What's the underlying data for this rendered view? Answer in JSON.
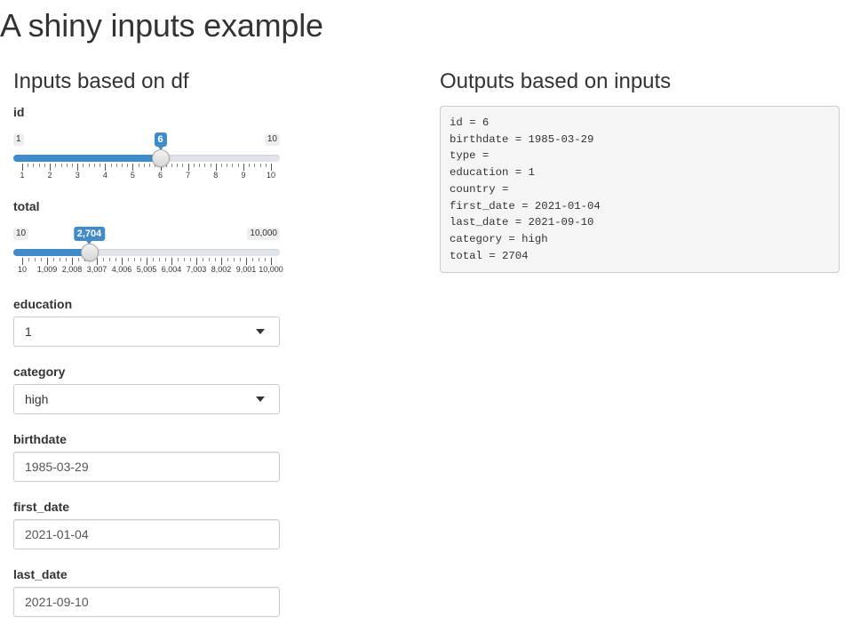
{
  "app": {
    "title": "A shiny inputs example"
  },
  "inputs_panel": {
    "title": "Inputs based on df",
    "id_slider": {
      "label": "id",
      "min_label": "1",
      "max_label": "10",
      "value_label": "6",
      "min": 1,
      "max": 10,
      "value": 6,
      "ticks": [
        "1",
        "2",
        "3",
        "4",
        "5",
        "6",
        "7",
        "8",
        "9",
        "10"
      ]
    },
    "total_slider": {
      "label": "total",
      "min_label": "10",
      "max_label": "10,000",
      "value_label": "2,704",
      "min": 10,
      "max": 10000,
      "value": 2704,
      "ticks": [
        "10",
        "1,009",
        "2,008",
        "3,007",
        "4,006",
        "5,005",
        "6,004",
        "7,003",
        "8,002",
        "9,001",
        "10,000"
      ]
    },
    "education": {
      "label": "education",
      "value": "1"
    },
    "category": {
      "label": "category",
      "value": "high"
    },
    "birthdate": {
      "label": "birthdate",
      "value": "1985-03-29"
    },
    "first_date": {
      "label": "first_date",
      "value": "2021-01-04"
    },
    "last_date": {
      "label": "last_date",
      "value": "2021-09-10"
    }
  },
  "outputs_panel": {
    "title": "Outputs based on inputs",
    "lines": [
      "id = 6",
      "birthdate = 1985-03-29",
      "type = ",
      "education = 1",
      "country = ",
      "first_date = 2021-01-04",
      "last_date = 2021-09-10",
      "category = high",
      "total = 2704"
    ]
  },
  "colors": {
    "accent": "#428bca",
    "output_bg": "#f5f5f5"
  }
}
